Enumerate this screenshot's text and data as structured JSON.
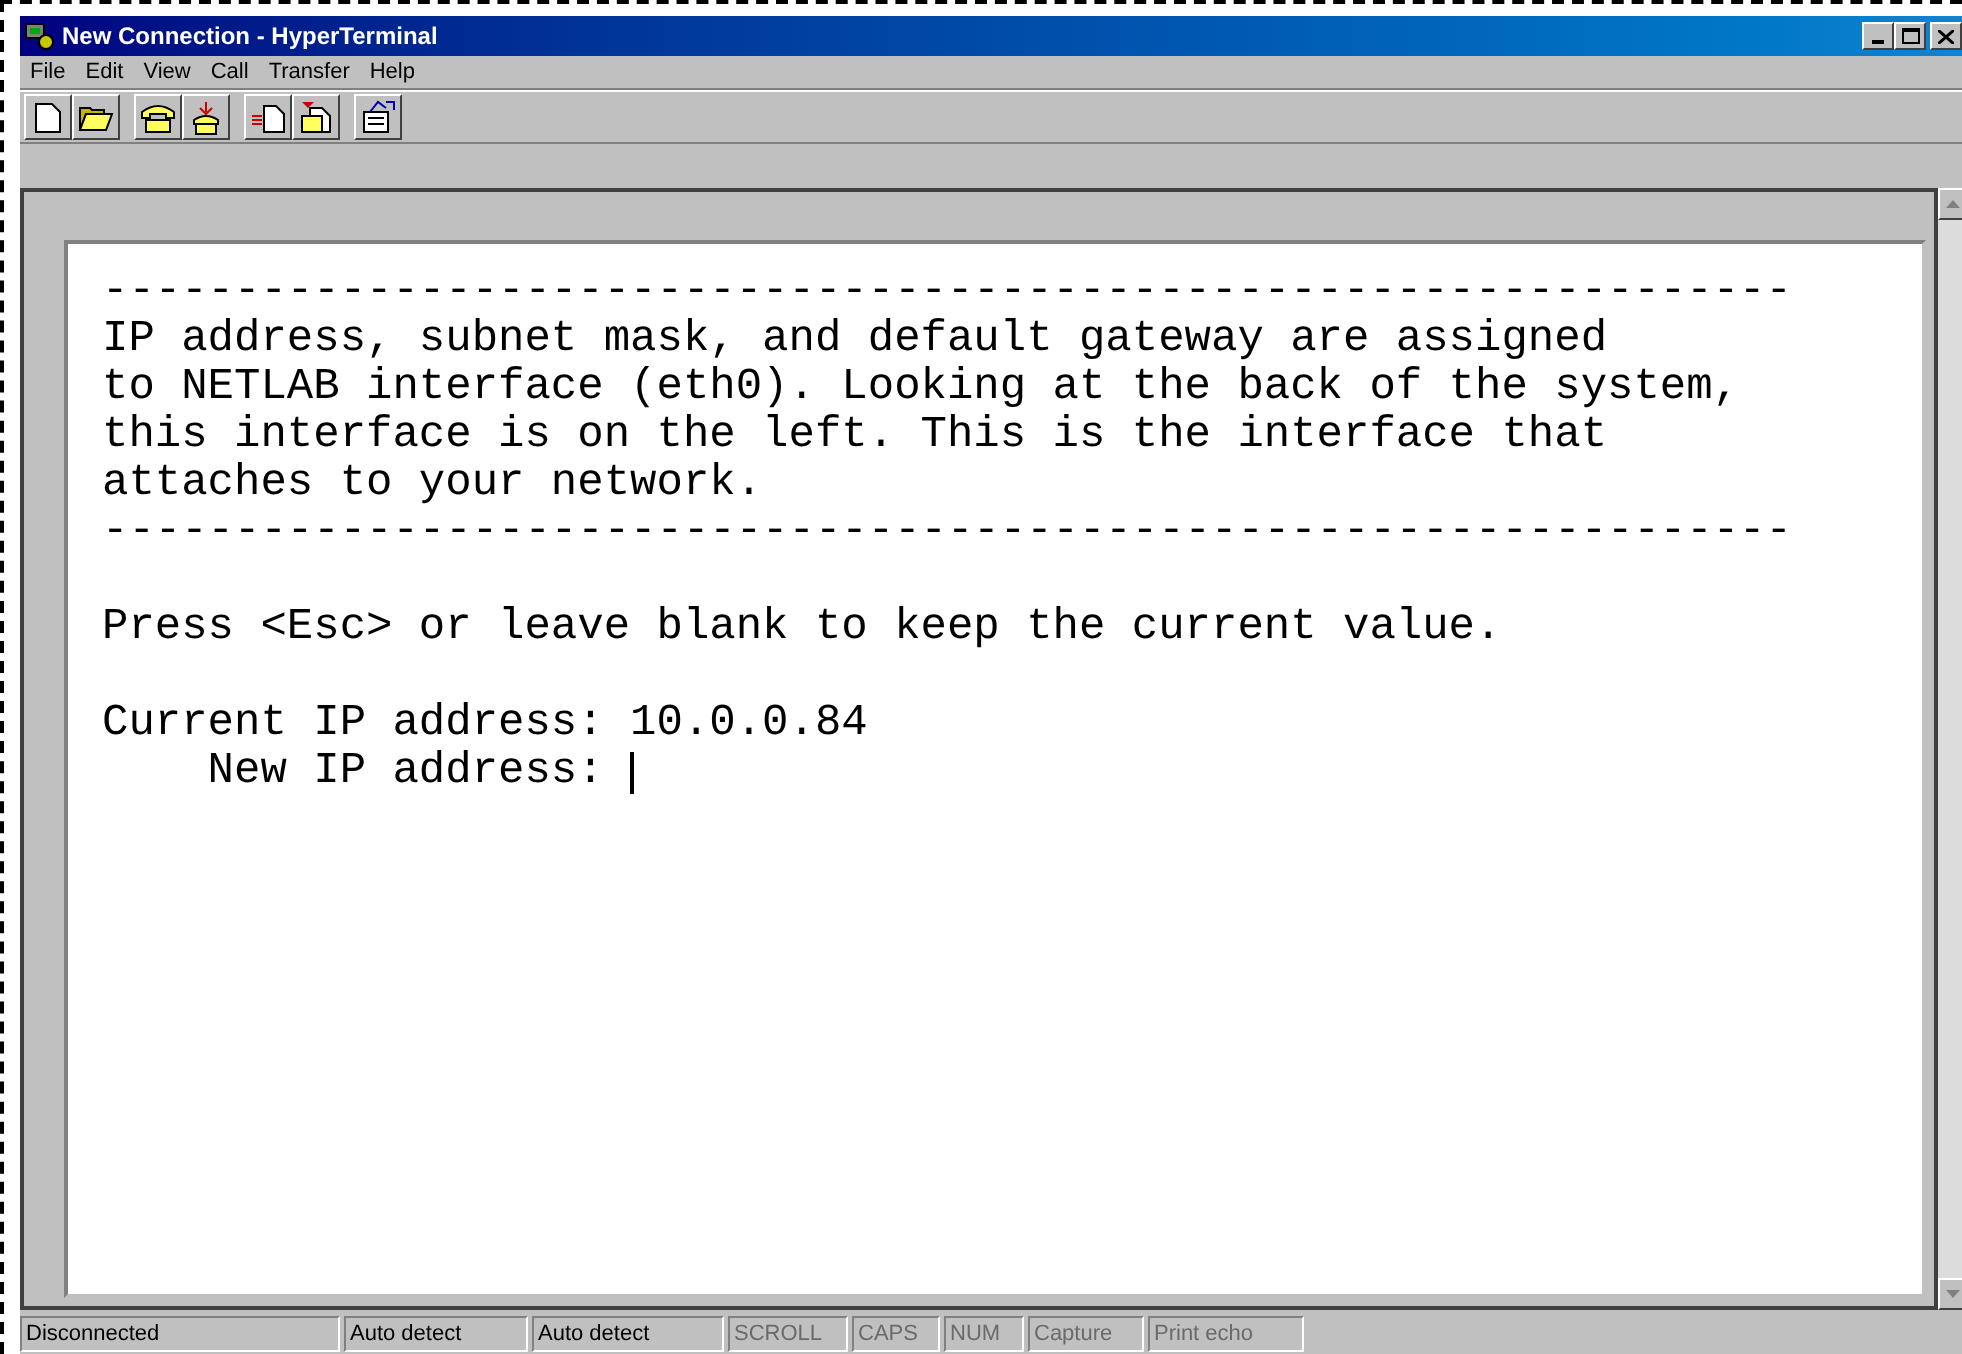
{
  "window": {
    "title": "New Connection - HyperTerminal"
  },
  "menu": [
    "File",
    "Edit",
    "View",
    "Call",
    "Transfer",
    "Help"
  ],
  "toolbar": [
    {
      "kind": "new"
    },
    {
      "kind": "open"
    },
    {
      "kind": "gap"
    },
    {
      "kind": "call"
    },
    {
      "kind": "hangup"
    },
    {
      "kind": "gap"
    },
    {
      "kind": "send"
    },
    {
      "kind": "receive"
    },
    {
      "kind": "gap"
    },
    {
      "kind": "properties"
    }
  ],
  "terminal": {
    "lines": [
      "----------------------------------------------------------------",
      "IP address, subnet mask, and default gateway are assigned",
      "to NETLAB interface (eth0). Looking at the back of the system,",
      "this interface is on the left. This is the interface that",
      "attaches to your network.",
      "----------------------------------------------------------------",
      {
        "text": "Press <Esc> or leave blank to keep the current value.",
        "space_before": true
      },
      {
        "text": "Current IP address: 10.0.0.84",
        "space_before": true
      },
      "    New IP address: "
    ],
    "cursor": true
  },
  "status_bar": [
    {
      "text": "Disconnected",
      "disabled": false
    },
    {
      "text": "Auto detect",
      "disabled": false
    },
    {
      "text": "Auto detect",
      "disabled": false
    },
    {
      "text": "SCROLL",
      "disabled": true
    },
    {
      "text": "CAPS",
      "disabled": true
    },
    {
      "text": "NUM",
      "disabled": true
    },
    {
      "text": "Capture",
      "disabled": true
    },
    {
      "text": "Print echo",
      "disabled": true
    }
  ]
}
